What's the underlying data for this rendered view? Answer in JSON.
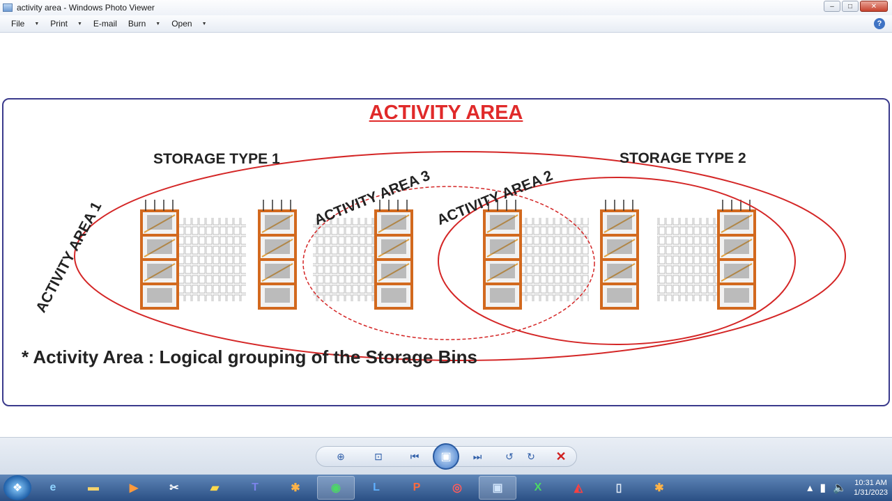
{
  "window": {
    "title": "activity area - Windows Photo Viewer",
    "buttons": {
      "minimize": "–",
      "maximize": "□",
      "close": "✕"
    }
  },
  "menu": {
    "items": [
      {
        "label": "File",
        "dropdown": true
      },
      {
        "label": "Print",
        "dropdown": true
      },
      {
        "label": "E-mail",
        "dropdown": false
      },
      {
        "label": "Burn",
        "dropdown": true
      },
      {
        "label": "Open",
        "dropdown": true
      }
    ],
    "help_icon": "?"
  },
  "slide": {
    "title": "ACTIVITY AREA",
    "storage_type_1": "STORAGE TYPE 1",
    "storage_type_2": "STORAGE TYPE 2",
    "activity_area_1": "ACTIVITY AREA 1",
    "activity_area_2": "ACTIVITY AREA 2",
    "activity_area_3": "ACTIVITY AREA 3",
    "footnote": "* Activity Area : Logical grouping of the Storage Bins",
    "colors": {
      "title": "#e02a2a",
      "ellipse": "#d42626",
      "border": "#3a3a8c",
      "rack_frame": "#d2691e"
    }
  },
  "controls": {
    "icons": [
      "zoom-icon",
      "actual-size-icon",
      "previous-icon",
      "slideshow-icon",
      "next-icon",
      "rotate-left-icon",
      "rotate-right-icon",
      "delete-icon"
    ]
  },
  "taskbar": {
    "apps": [
      "internet-explorer",
      "file-explorer",
      "media-player",
      "snipping-tool",
      "sticky-notes",
      "teams",
      "app",
      "chrome",
      "lync",
      "powerpoint",
      "app",
      "photo-viewer",
      "excel",
      "acrobat",
      "notepad",
      "app"
    ],
    "teams_label": "T",
    "lync_label": "L",
    "powerpoint_label": "P",
    "excel_label": "X",
    "time": "10:31 AM",
    "date": "1/31/2023"
  }
}
